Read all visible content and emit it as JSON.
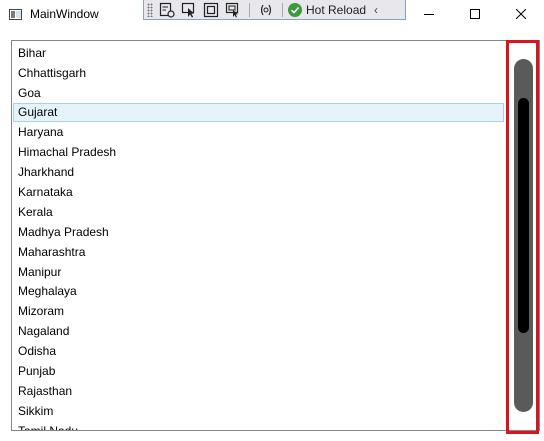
{
  "window": {
    "title": "MainWindow",
    "icons": {
      "app": "window-app-icon",
      "minimize": "minimize-icon",
      "maximize": "maximize-icon",
      "close": "close-icon"
    }
  },
  "debug_toolbar": {
    "hot_reload_label": "Hot Reload",
    "icons": [
      "grip-icon",
      "live-visual-tree-icon",
      "select-element-icon",
      "display-layout-adorners-icon",
      "track-focus-icon",
      "binding-failures-icon",
      "hot-reload-check-icon",
      "collapse-chevron-icon"
    ]
  },
  "list": {
    "items": [
      "Bihar",
      "Chhattisgarh",
      "Goa",
      "Gujarat",
      "Haryana",
      "Himachal Pradesh",
      "Jharkhand",
      "Karnataka",
      "Kerala",
      "Madhya Pradesh",
      "Maharashtra",
      "Manipur",
      "Meghalaya",
      "Mizoram",
      "Nagaland",
      "Odisha",
      "Punjab",
      "Rajasthan",
      "Sikkim",
      "Tamil Nadu"
    ],
    "selected_index": 3
  },
  "colors": {
    "selection_background": "#e5f3fb",
    "selection_border": "#a8d2ec",
    "scroll_track": "#5a5a5a",
    "scroll_thumb": "#000000",
    "highlight_box": "#d8141e",
    "hot_reload_check": "#3c9a3c"
  }
}
